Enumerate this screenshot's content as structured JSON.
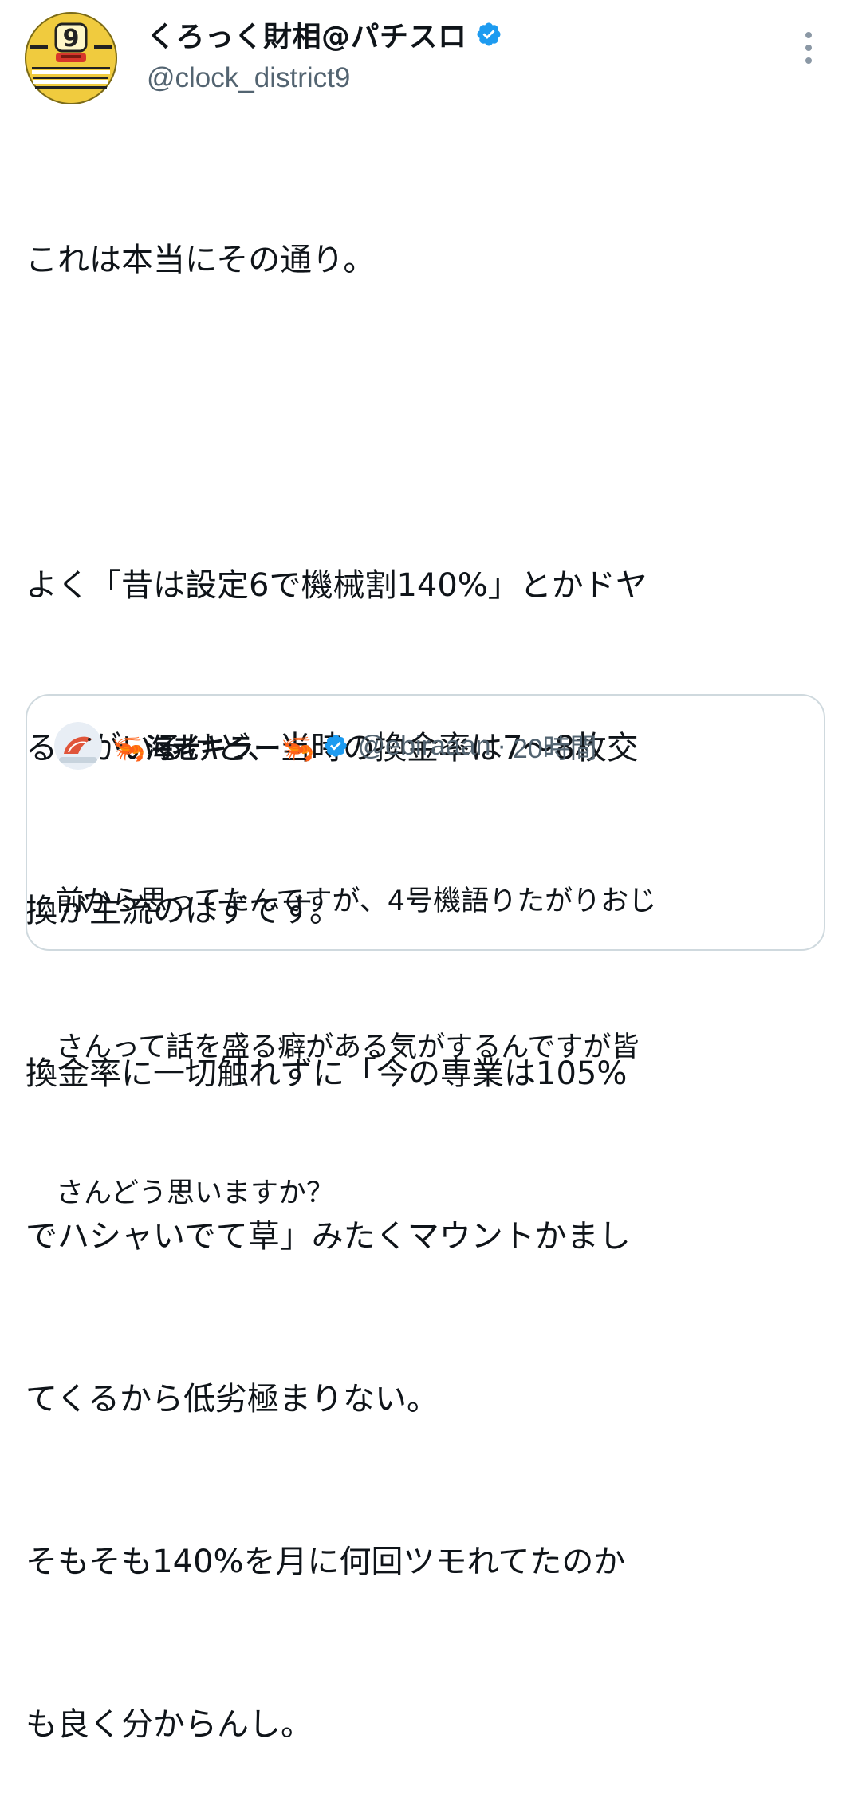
{
  "tweet": {
    "author": {
      "display_name": "くろっく財相@パチスロ",
      "handle": "@clock_district9",
      "verified": true,
      "avatar_icon": "pixel-face-avatar"
    },
    "more_icon": "vertical-ellipsis-icon",
    "body_lines": [
      "これは本当にその通り。",
      "",
      "よく「昔は設定6で機械割140%」とかドヤ",
      "る人がいるけど、当時の換金率は7〜8枚交",
      "換が主流のはずです。",
      "換金率に一切触れずに「今の専業は105%",
      "でハシャいでて草」みたくマウントかまし",
      "てくるから低劣極まりない。",
      "そもそも140%を月に何回ツモれてたのか",
      "も良く分からんし。"
    ]
  },
  "quoted_tweet": {
    "display_name": "🦐海老キラー🦐",
    "verified": true,
    "handle": "@ebiraaan",
    "separator": "·",
    "time": "20時間",
    "avatar_icon": "shrimp-avatar",
    "body_lines": [
      "前から思ってたんですが、4号機語りたがりおじ",
      "さんって話を盛る癖がある気がするんですが皆",
      "さんどう思いますか？"
    ]
  },
  "colors": {
    "text": "#0f1419",
    "secondary_text": "#536471",
    "verified_blue": "#1d9bf0",
    "border": "#cfd9de"
  }
}
